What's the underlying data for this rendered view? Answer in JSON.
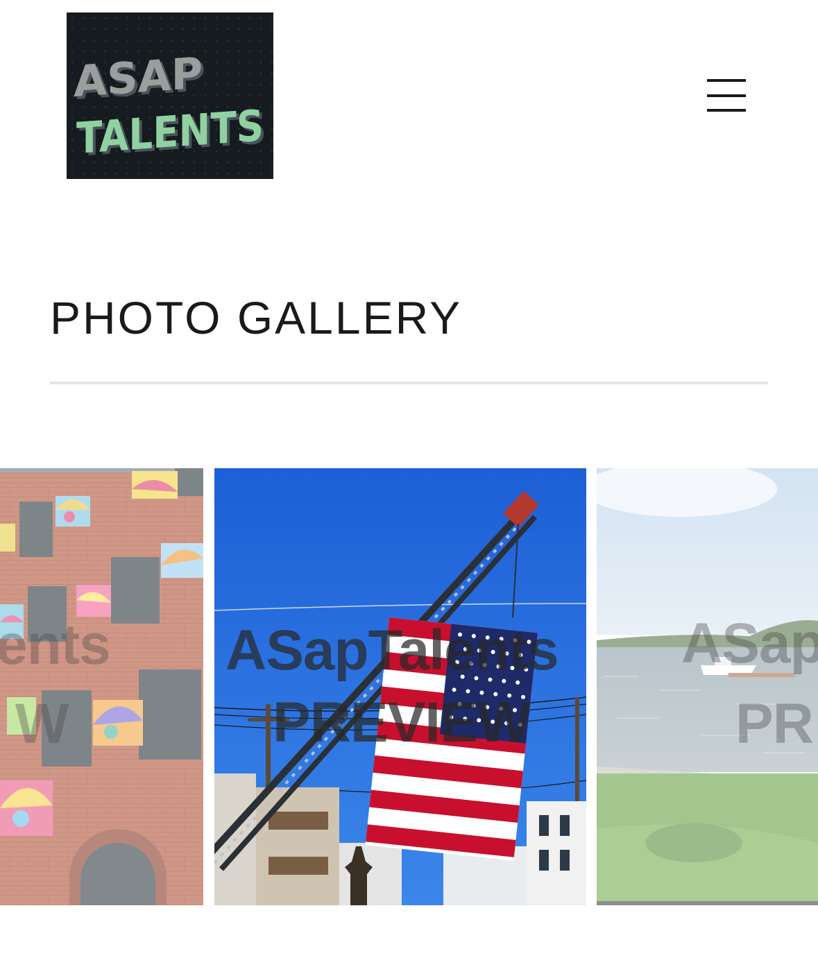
{
  "header": {
    "logo": {
      "line1": "ASAP",
      "line2": "TALENTS",
      "text_color": "#8fd1a0",
      "shadow_color": "#5a6470",
      "bg_color": "#161b20"
    },
    "menu_icon": "hamburger-menu-icon"
  },
  "page": {
    "title": "PHOTO GALLERY"
  },
  "gallery": {
    "watermark_line1": "ASapTalents",
    "watermark_line2": "PREVIEW",
    "slides": [
      {
        "subject": "brick-building-with-painted-panels",
        "watermark_line1": "ents",
        "watermark_line2": "W"
      },
      {
        "subject": "fire-truck-ladder-with-american-flag",
        "watermark_line1": "ASapTalents",
        "watermark_line2": "PREVIEW"
      },
      {
        "subject": "lake-shore-with-boat",
        "watermark_line1": "ASap",
        "watermark_line2": "PR"
      }
    ]
  }
}
